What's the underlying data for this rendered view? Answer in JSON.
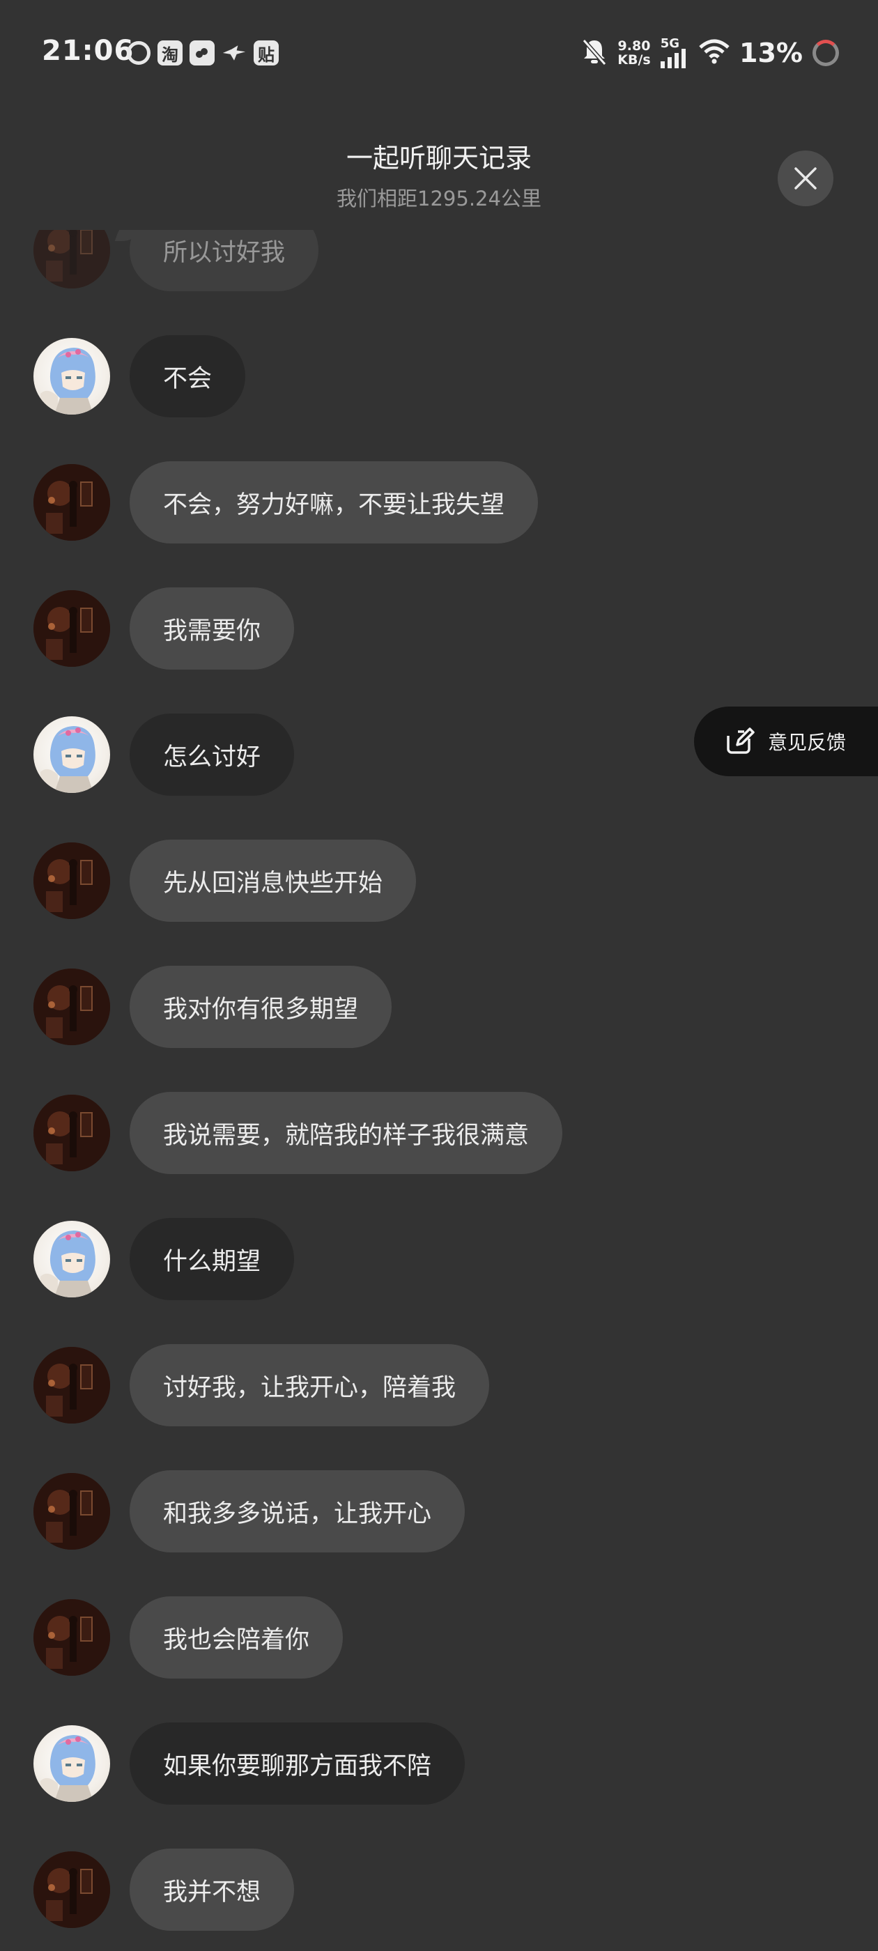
{
  "status_bar": {
    "time": "21:06",
    "app_icons": [
      "weibo-icon",
      "taobao-icon",
      "cloud-icon",
      "bird-icon",
      "tieba-icon"
    ],
    "taobao_label": "淘",
    "tieba_label": "贴",
    "net_speed_value": "9.80",
    "net_speed_unit": "KB/s",
    "network_type": "5G",
    "battery": "13%"
  },
  "header": {
    "title": "一起听聊天记录",
    "subtitle": "我们相距1295.24公里"
  },
  "feedback": {
    "label": "意见反馈"
  },
  "messages": [
    {
      "avatar": "dark",
      "bubble": "grey",
      "text": "所以讨好我"
    },
    {
      "avatar": "light",
      "bubble": "dark",
      "text": "不会"
    },
    {
      "avatar": "dark",
      "bubble": "grey",
      "text": "不会，努力好嘛，不要让我失望"
    },
    {
      "avatar": "dark",
      "bubble": "grey",
      "text": "我需要你"
    },
    {
      "avatar": "light",
      "bubble": "dark",
      "text": "怎么讨好"
    },
    {
      "avatar": "dark",
      "bubble": "grey",
      "text": "先从回消息快些开始"
    },
    {
      "avatar": "dark",
      "bubble": "grey",
      "text": "我对你有很多期望"
    },
    {
      "avatar": "dark",
      "bubble": "grey",
      "text": "我说需要，就陪我的样子我很满意"
    },
    {
      "avatar": "light",
      "bubble": "dark",
      "text": "什么期望"
    },
    {
      "avatar": "dark",
      "bubble": "grey",
      "text": "讨好我，让我开心，陪着我"
    },
    {
      "avatar": "dark",
      "bubble": "grey",
      "text": "和我多多说话，让我开心"
    },
    {
      "avatar": "dark",
      "bubble": "grey",
      "text": "我也会陪着你"
    },
    {
      "avatar": "light",
      "bubble": "dark",
      "text": "如果你要聊那方面我不陪"
    },
    {
      "avatar": "dark",
      "bubble": "grey",
      "text": "我并不想"
    }
  ]
}
